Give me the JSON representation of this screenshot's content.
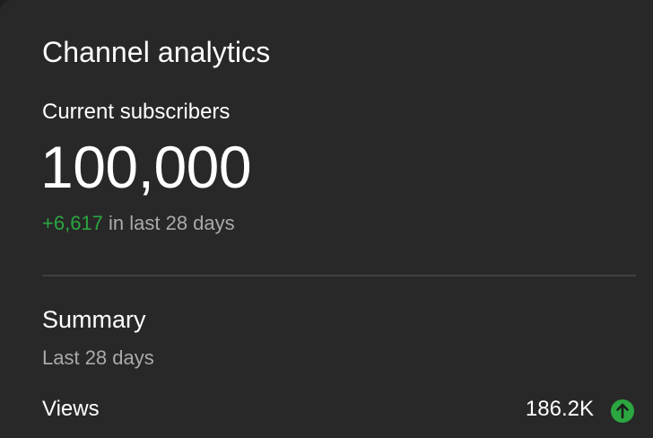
{
  "card": {
    "title": "Channel analytics",
    "subscribers": {
      "label": "Current subscribers",
      "count": "100,000",
      "delta_value": "+6,617",
      "delta_suffix": " in last 28 days"
    },
    "summary": {
      "title": "Summary",
      "period": "Last 28 days",
      "metrics": [
        {
          "label": "Views",
          "value": "186.2K",
          "trend_icon": "arrow-up-icon"
        }
      ]
    }
  },
  "colors": {
    "background": "#282828",
    "positive": "#2ba640",
    "secondary_text": "#aaaaaa",
    "divider": "#3e3e3e"
  }
}
